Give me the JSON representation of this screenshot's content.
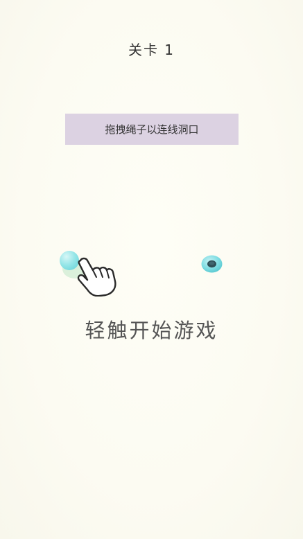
{
  "level": {
    "title": "关卡 1"
  },
  "hint": {
    "text": "拖拽绳子以连线洞口"
  },
  "game": {
    "rope_ball_color": "#7fdde3",
    "hole_color": "#7fdde3",
    "hand_icon": "pointing-hand-icon"
  },
  "prompt": {
    "text": "轻触开始游戏"
  },
  "colors": {
    "background": "#fdfcf3",
    "banner": "#dcd2e2",
    "text": "#333333"
  }
}
